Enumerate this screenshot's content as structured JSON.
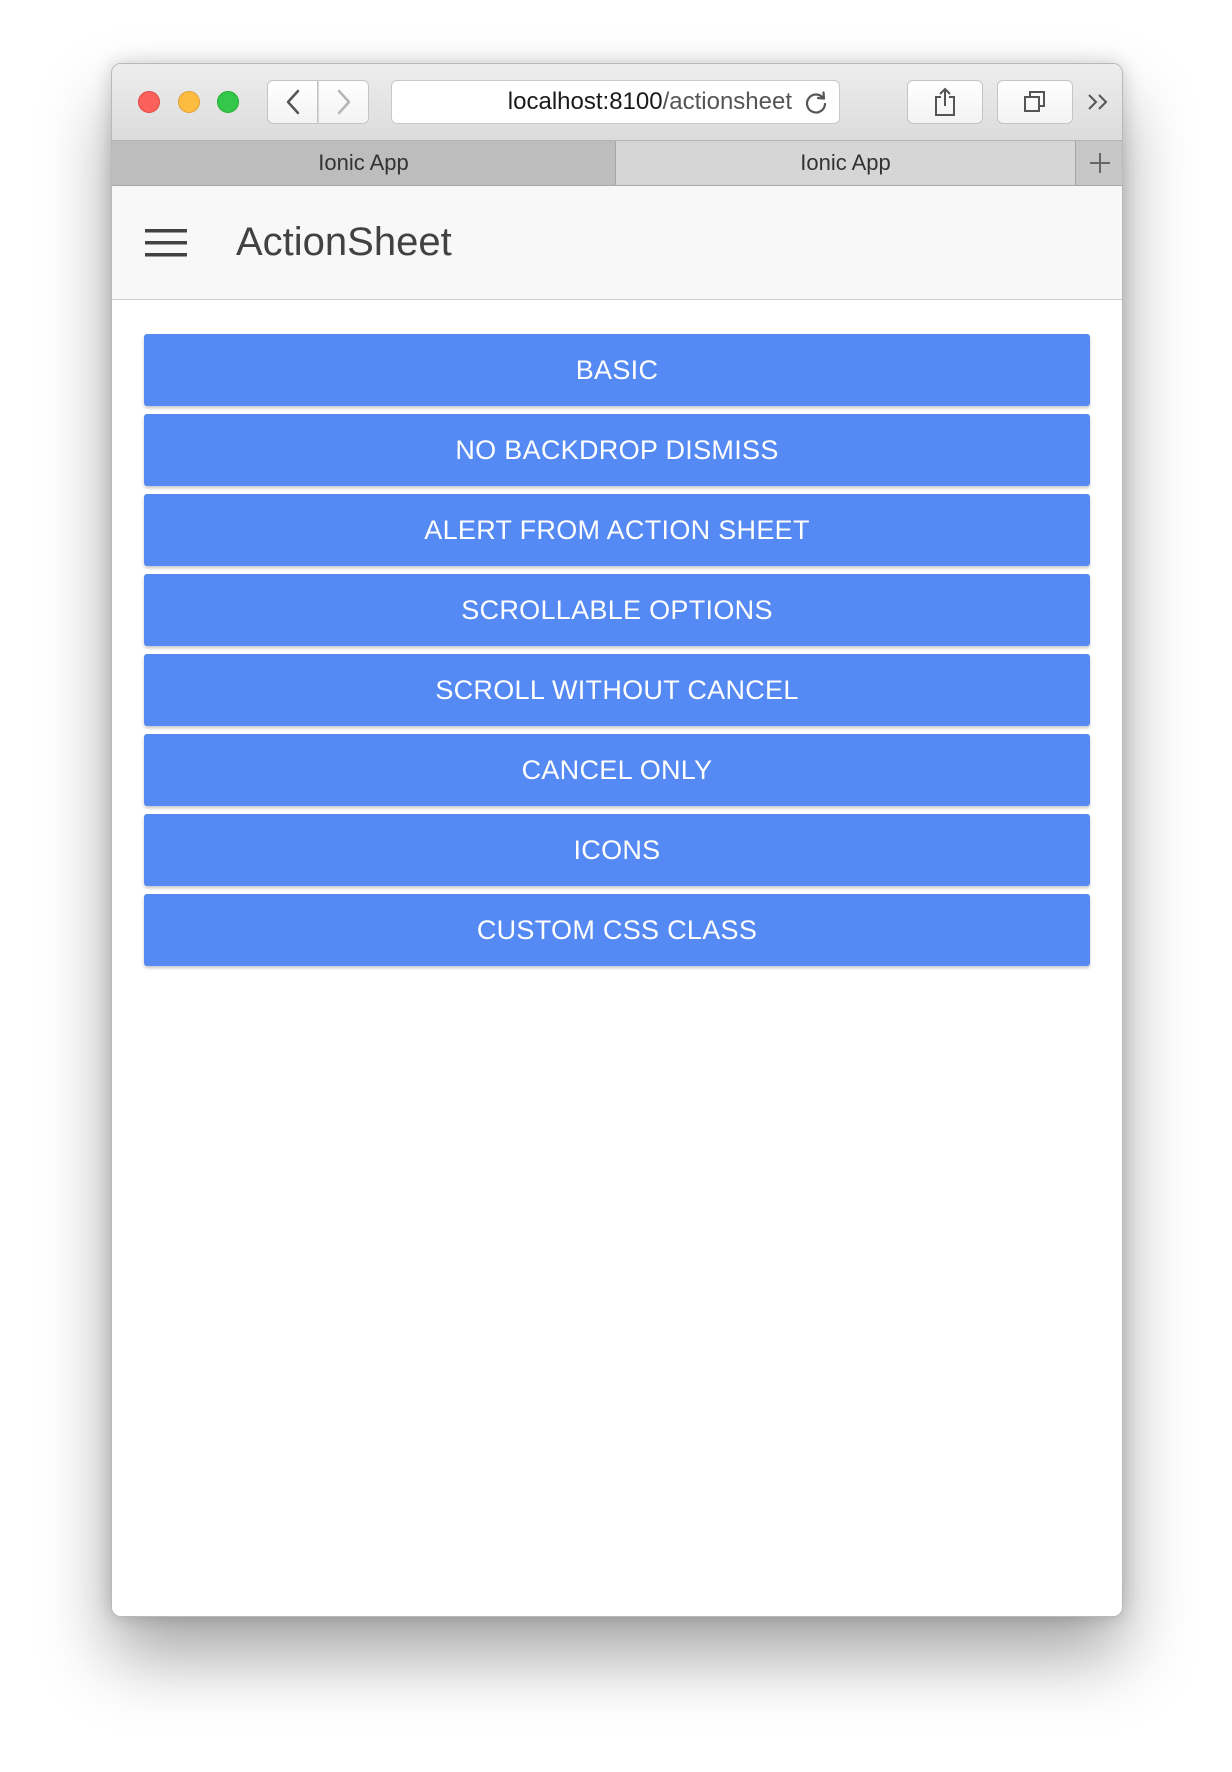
{
  "browser": {
    "url_host": "localhost:8100",
    "url_path": "/actionsheet",
    "tabs": [
      {
        "label": "Ionic App"
      },
      {
        "label": "Ionic App"
      }
    ]
  },
  "header": {
    "title": "ActionSheet"
  },
  "main": {
    "buttons": [
      {
        "label": "BASIC"
      },
      {
        "label": "NO BACKDROP DISMISS"
      },
      {
        "label": "ALERT FROM ACTION SHEET"
      },
      {
        "label": "SCROLLABLE OPTIONS"
      },
      {
        "label": "SCROLL WITHOUT CANCEL"
      },
      {
        "label": "CANCEL ONLY"
      },
      {
        "label": "ICONS"
      },
      {
        "label": "CUSTOM CSS CLASS"
      }
    ]
  },
  "colors": {
    "button_primary": "#5589f4",
    "button_text": "#ffffff",
    "header_background": "#f8f8f8",
    "title_text": "#424242"
  },
  "icons": {
    "toolbar": [
      "back-icon",
      "forward-icon",
      "reload-icon",
      "share-icon",
      "tabs-overview-icon",
      "more-icon",
      "new-tab-icon"
    ],
    "header": [
      "menu-icon"
    ]
  }
}
